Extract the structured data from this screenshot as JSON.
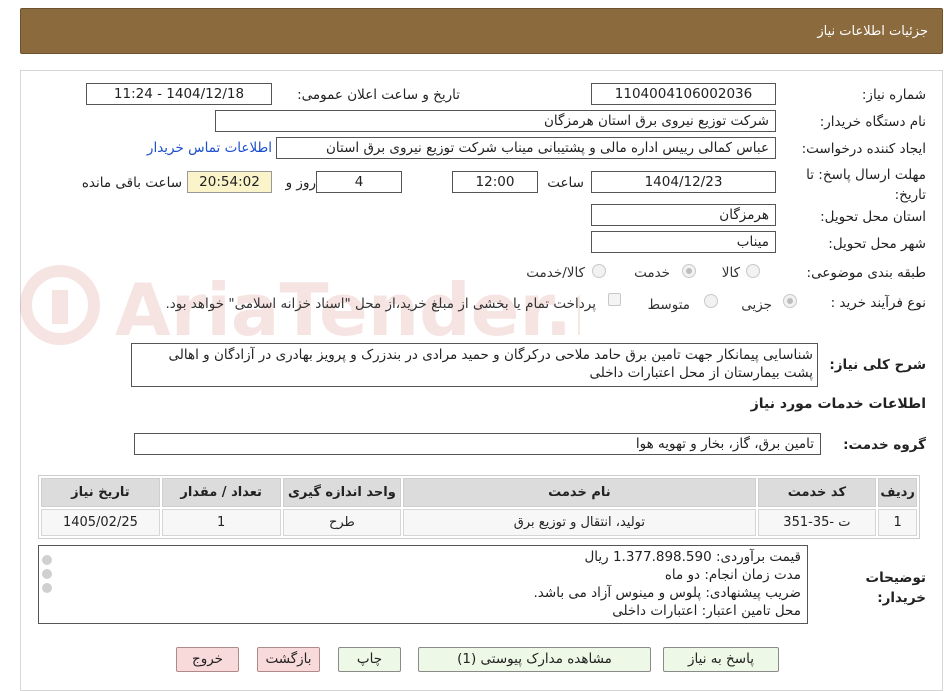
{
  "header": {
    "title": "جزئیات اطلاعات نیاز"
  },
  "fields": {
    "need_number_label": "شماره نیاز:",
    "need_number": "1104004106002036",
    "announce_label": "تاریخ و ساعت اعلان عمومی:",
    "announce_value": "1404/12/18 - 11:24",
    "buyer_label": "نام دستگاه خریدار:",
    "buyer_value": "شرکت توزیع نیروی برق استان هرمزگان",
    "requester_label": "ایجاد کننده درخواست:",
    "requester_value": "عباس کمالی رییس اداره مالی و پشتیبانی میناب شرکت توزیع نیروی برق استان",
    "contact_link": "اطلاعات تماس خریدار",
    "deadline_label": "مهلت ارسال پاسخ: تا تاریخ:",
    "deadline_date": "1404/12/23",
    "time_label": "ساعت",
    "deadline_time": "12:00",
    "days_value": "4",
    "days_label": "روز و",
    "remaining_time": "20:54:02",
    "remaining_label": "ساعت باقی مانده",
    "province_label": "استان محل تحویل:",
    "province_value": "هرمزگان",
    "city_label": "شهر محل تحویل:",
    "city_value": "میناب",
    "category_label": "طبقه بندی موضوعی:",
    "category_options": [
      "کالا",
      "خدمت",
      "کالا/خدمت"
    ],
    "process_label": "نوع فرآیند خرید :",
    "process_options": [
      "جزیی",
      "متوسط"
    ],
    "process_note": "پرداخت تمام یا بخشی از مبلغ خرید،از محل \"اسناد خزانه اسلامی\" خواهد بود.",
    "desc_label": "شرح کلی نیاز:",
    "desc_value": "شناسایی پیمانکار جهت تامین برق حامد ملاحی درکرگان  و حمید مرادی در بندزرک و پرویز بهادری در آزادگان و اهالی پشت بیمارستان از محل اعتبارات داخلی"
  },
  "services": {
    "section_title": "اطلاعات خدمات مورد نیاز",
    "group_label": "گروه خدمت:",
    "group_value": "تامین برق، گاز، بخار و تهویه هوا",
    "columns": [
      "ردیف",
      "کد خدمت",
      "نام خدمت",
      "واحد اندازه گیری",
      "تعداد / مقدار",
      "تاریخ نیاز"
    ],
    "rows": [
      [
        "1",
        "ت -35-351",
        "تولید، انتقال و توزیع برق",
        "طرح",
        "1",
        "1405/02/25"
      ]
    ]
  },
  "notes": {
    "label": "توضیحات خریدار:",
    "lines": [
      "قیمت برآوردی: 1.377.898.590 ریال",
      "مدت زمان انجام: دو ماه",
      "ضریب پیشنهادی: پلوس  و مینوس آزاد می باشد.",
      "محل تامین اعتبار:  اعتبارات داخلی"
    ]
  },
  "buttons": {
    "reply": "پاسخ به نیاز",
    "attachments": "مشاهده مدارک پیوستی (1)",
    "print": "چاپ",
    "back": "بازگشت",
    "exit": "خروج"
  },
  "watermark_text": "AriaTender.neT",
  "colors": {
    "header_bg": "#8b6a3e",
    "button_bg": "#eef8e6",
    "button_red_bg": "#f9dada",
    "highlight": "#fbf3c9",
    "link": "#1a4fcf"
  }
}
